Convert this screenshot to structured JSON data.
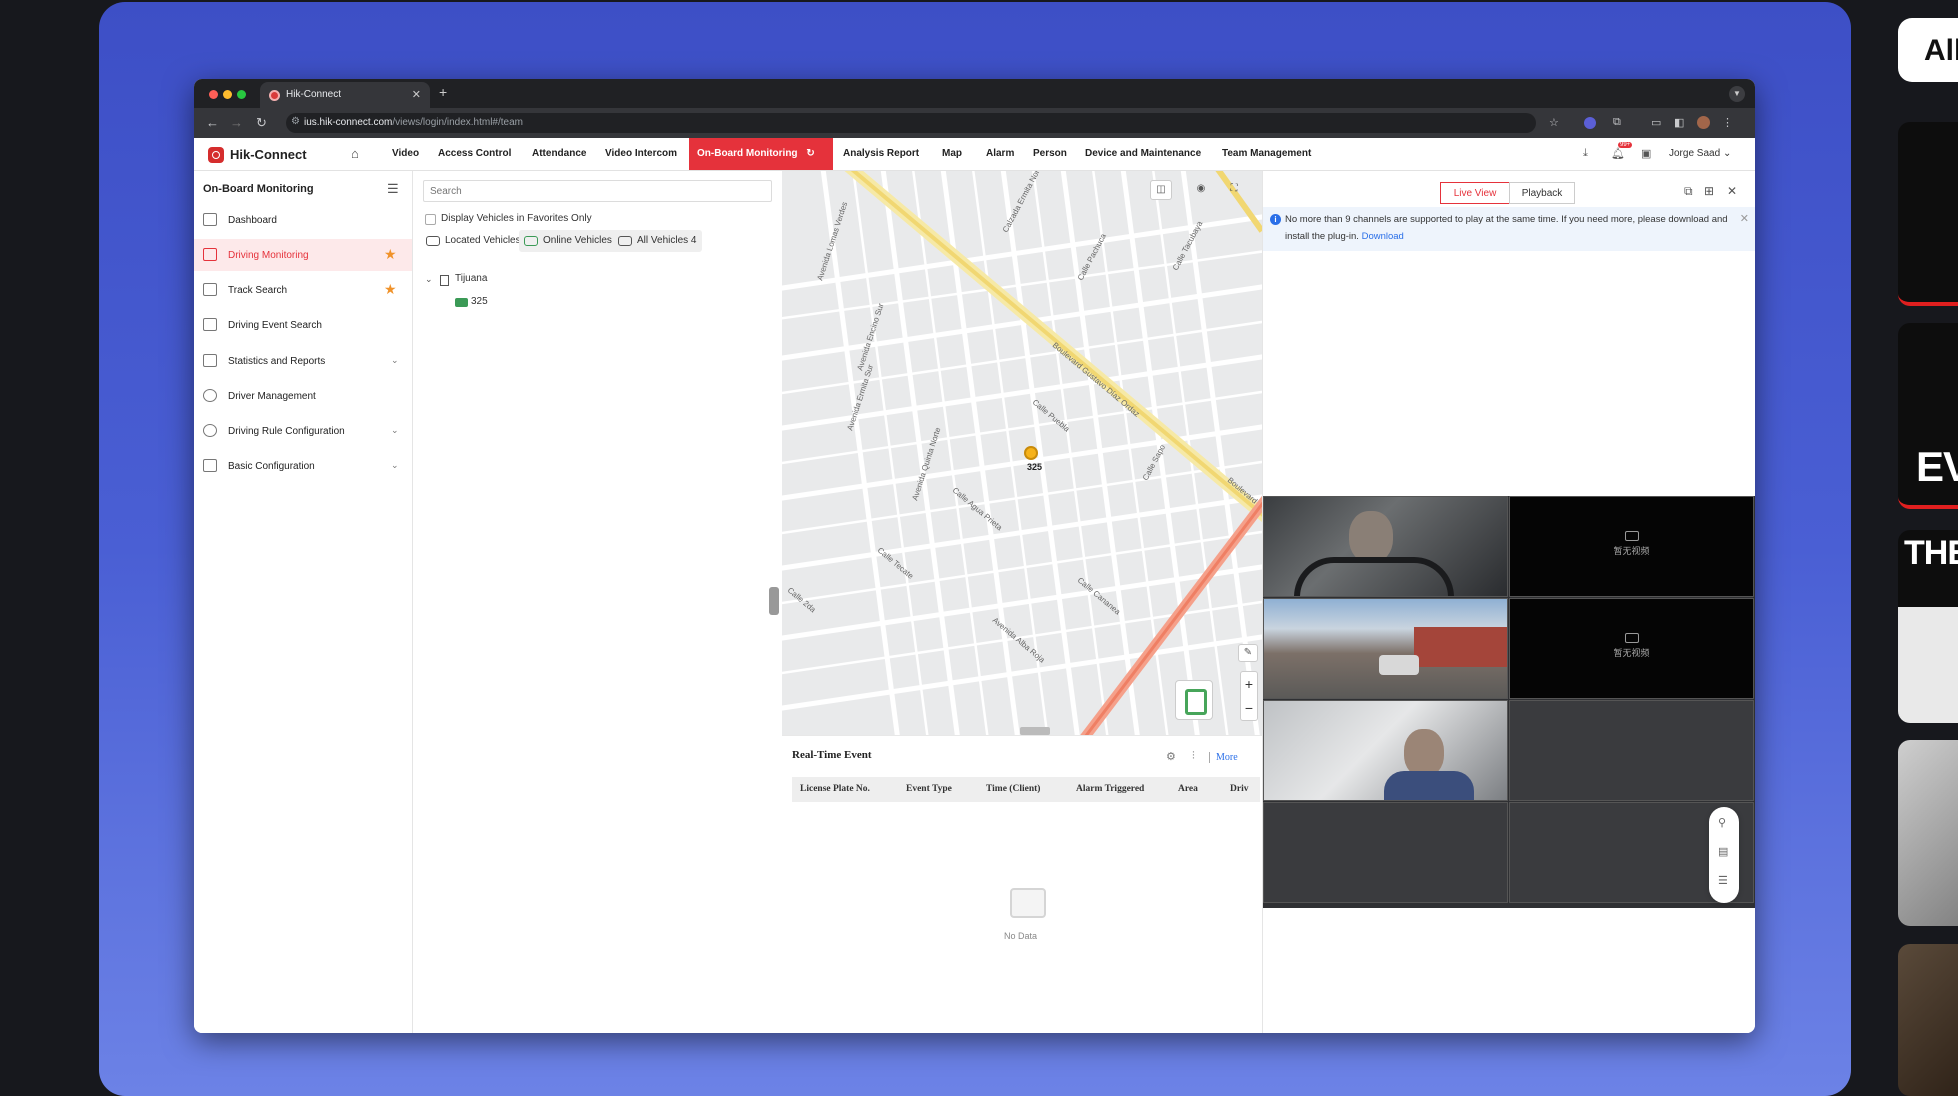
{
  "browser": {
    "tab_title": "Hik-Connect",
    "url_host": "ius.hik-connect.com",
    "url_path": "/views/login/index.html#/team"
  },
  "app": {
    "brand": "Hik-Connect",
    "menu": [
      "Video",
      "Access Control",
      "Attendance",
      "Video Intercom"
    ],
    "menu_active": "On-Board Monitoring",
    "menu_after": [
      "Analysis Report",
      "Map",
      "Alarm",
      "Person",
      "Device and Maintenance",
      "Team Management"
    ],
    "user": "Jorge Saad",
    "notif_badge": "99+"
  },
  "sidebar": {
    "title": "On-Board Monitoring",
    "items": [
      {
        "label": "Dashboard"
      },
      {
        "label": "Driving Monitoring"
      },
      {
        "label": "Track Search"
      },
      {
        "label": "Driving Event Search"
      },
      {
        "label": "Statistics and Reports"
      },
      {
        "label": "Driver Management"
      },
      {
        "label": "Driving Rule Configuration"
      },
      {
        "label": "Basic Configuration"
      }
    ]
  },
  "vehicles": {
    "search_placeholder": "Search",
    "favorites_label": "Display Vehicles in Favorites Only",
    "filters": [
      "Located Vehicles 1",
      "Online Vehicles 1",
      "All Vehicles 4"
    ],
    "tree": {
      "org": "Tijuana",
      "vehicle": "325"
    }
  },
  "map": {
    "vehicle_label": "325",
    "streets": [
      "Calzada Ermita Norte",
      "Boulevard Gustavo Díaz Ordaz",
      "Calle Puebla",
      "Avenida Quinta Norte",
      "Calle Agua Prieta",
      "Calle Cananea",
      "Avenida Alba Roja",
      "Calle Tacubaya",
      "Calle Sapo",
      "Boulevard",
      "Avenida Lomas Verdes",
      "Calle Pachuca",
      "Avenida Encino Sur",
      "Calle Tecate",
      "Avenida Ermita Sur",
      "Calle 2da"
    ]
  },
  "realtime": {
    "title": "Real-Time Event",
    "more": "More",
    "columns": [
      "License Plate No.",
      "Event Type",
      "Time (Client)",
      "Alarm Triggered",
      "Area",
      "Driv"
    ],
    "empty": "No Data"
  },
  "live": {
    "tab_live": "Live View",
    "tab_playback": "Playback",
    "notice": "No more than 9 channels are supported to play at the same time. If you need more, please download and install the plug-in.",
    "notice_link": "Download",
    "no_video": "暂无视频"
  },
  "background": {
    "pill_text": "All",
    "card_text_1": "EVI",
    "card_text_2": "THE"
  },
  "colors": {
    "accent": "#e5323b",
    "link": "#2a6fe8",
    "star": "#f0922a"
  }
}
